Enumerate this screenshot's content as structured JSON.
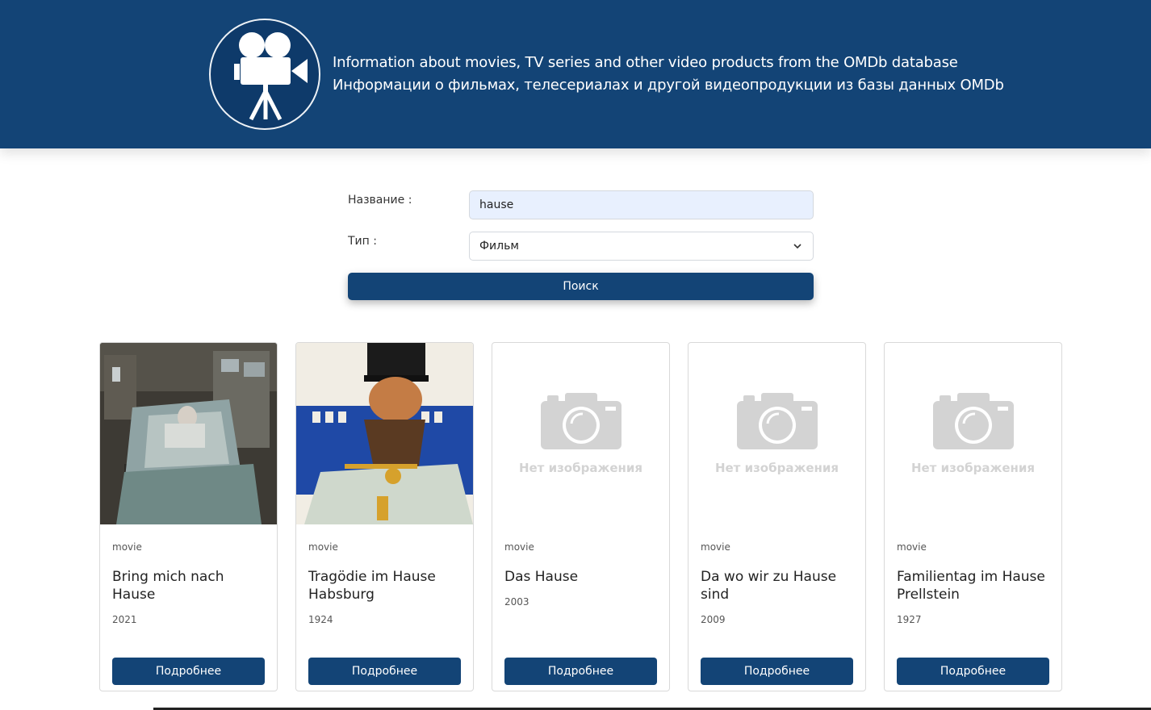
{
  "header": {
    "line_en": "Information about movies, TV series and other video products from the OMDb database",
    "line_ru": "Информации о фильмах, телесериалах и другой видеопродукции из базы данных OMDb",
    "logo_icon": "movie-camera-icon"
  },
  "form": {
    "title_label": "Название :",
    "title_value": "hause",
    "type_label": "Тип :",
    "type_value": "Фильм",
    "search_label": "Поиск"
  },
  "no_image_text": "Нет изображения",
  "cards": [
    {
      "type": "movie",
      "title": "Bring mich nach Hause",
      "year": "2021",
      "button": "Подробнее",
      "has_poster": true
    },
    {
      "type": "movie",
      "title": "Tragödie im Hause Habsburg",
      "year": "1924",
      "button": "Подробнее",
      "has_poster": true
    },
    {
      "type": "movie",
      "title": "Das Hause",
      "year": "2003",
      "button": "Подробнее",
      "has_poster": false
    },
    {
      "type": "movie",
      "title": "Da wo wir zu Hause sind",
      "year": "2009",
      "button": "Подробнее",
      "has_poster": false
    },
    {
      "type": "movie",
      "title": "Familientag im Hause Prellstein",
      "year": "1927",
      "button": "Подробнее",
      "has_poster": false
    }
  ],
  "colors": {
    "brand": "#134476",
    "input_autofill": "#e8f0fe",
    "placeholder_gray": "#d3d3d3"
  }
}
